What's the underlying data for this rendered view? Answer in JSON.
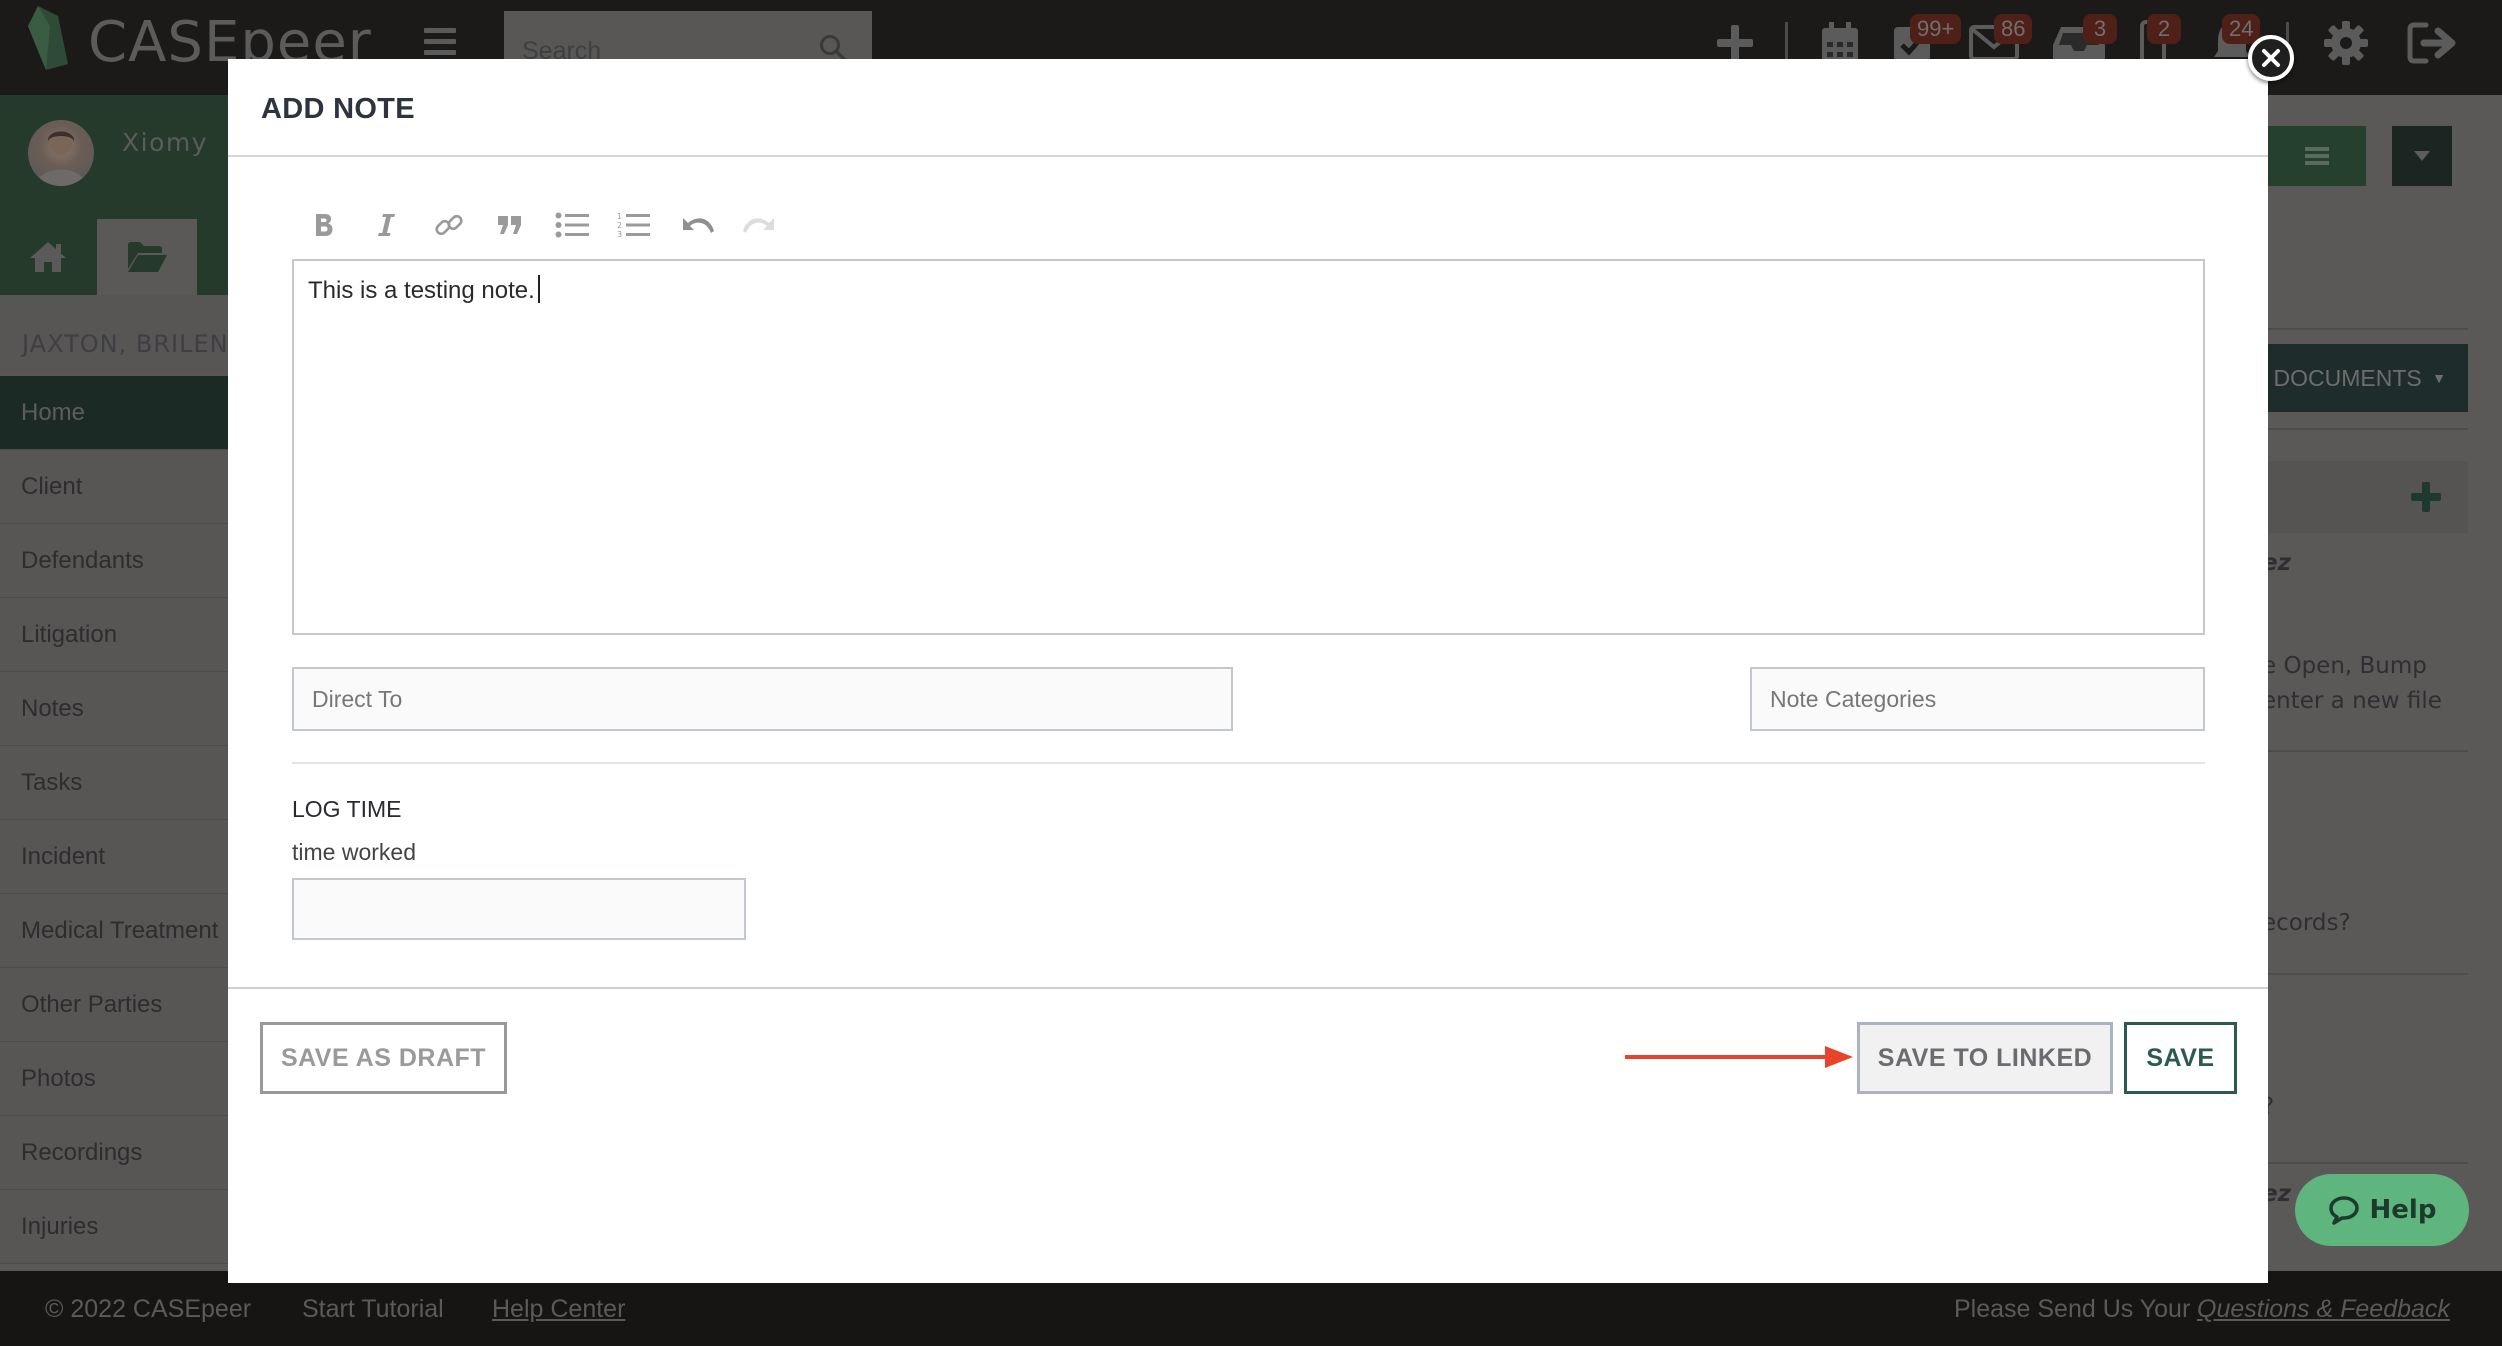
{
  "app": {
    "logo_text": "CASEpeer",
    "search_placeholder": "Search",
    "badges": {
      "tasks": "99+",
      "mail": "86",
      "inbox": "3",
      "phone": "2",
      "notifications": "24"
    },
    "user_name": "Xiomy",
    "client_name": "JAXTON, BRILENE",
    "sidebar": {
      "items": [
        {
          "label": "Home",
          "active": true
        },
        {
          "label": "Client"
        },
        {
          "label": "Defendants"
        },
        {
          "label": "Litigation"
        },
        {
          "label": "Notes"
        },
        {
          "label": "Tasks"
        },
        {
          "label": "Incident"
        },
        {
          "label": "Medical Treatment"
        },
        {
          "label": "Other Parties"
        },
        {
          "label": "Photos"
        },
        {
          "label": "Recordings"
        },
        {
          "label": "Injuries"
        }
      ]
    },
    "right_panel": {
      "documents_label": "DOCUMENTS",
      "texts": [
        "ez",
        "e Open, Bump",
        "enter a new file",
        "ecords?",
        "?",
        "ez"
      ]
    },
    "help_label": "Help",
    "footer": {
      "copyright": "© 2022 CASEpeer",
      "start_tutorial": "Start Tutorial",
      "help_center": "Help Center",
      "feedback_prefix": "Please Send Us Your",
      "feedback_link": "Questions & Feedback"
    }
  },
  "modal": {
    "title": "ADD NOTE",
    "toolbar": [
      "bold",
      "italic",
      "link",
      "quote",
      "bulleted-list",
      "numbered-list",
      "undo",
      "redo"
    ],
    "editor_text": "This is a testing note.",
    "direct_to_placeholder": "Direct To",
    "note_categories_placeholder": "Note Categories",
    "log_time_label": "LOG TIME",
    "time_worked_label": "time worked",
    "time_worked_value": "",
    "buttons": {
      "save_as_draft": "SAVE AS DRAFT",
      "save_to_linked": "SAVE TO LINKED",
      "save": "SAVE"
    },
    "annotation_arrow_color": "#e8432b"
  },
  "colors": {
    "brand_green": "#2a5a50",
    "help_green": "#5fb57e",
    "badge_red": "#4f2018"
  }
}
